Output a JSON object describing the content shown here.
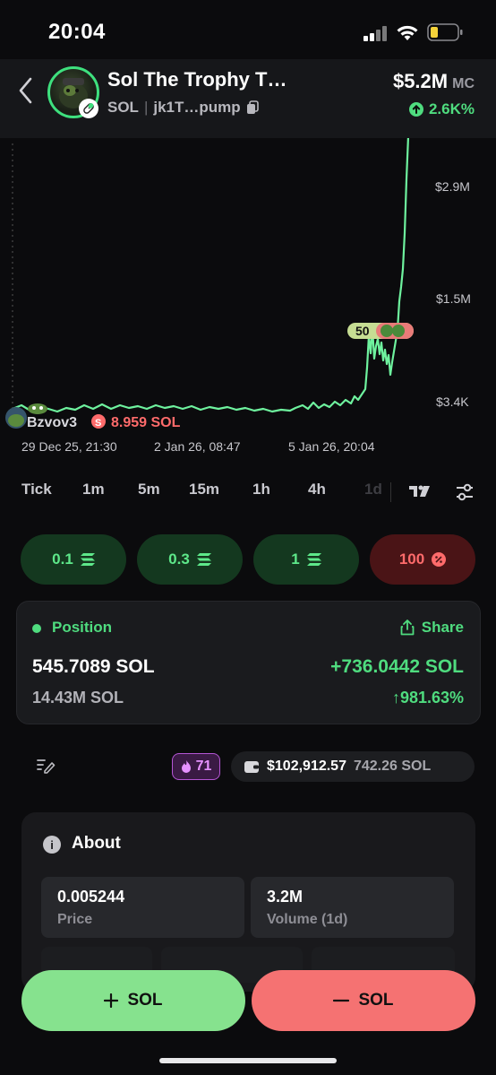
{
  "status_bar": {
    "time": "20:04"
  },
  "token": {
    "name": "Sol The Trophy T…",
    "chain": "SOL",
    "address": "jk1T…pump",
    "market_cap": "$5.2M",
    "market_cap_label": "MC",
    "change": "2.6K%"
  },
  "chart": {
    "y_labels": [
      "$2.9M",
      "$1.5M",
      "$3.4K"
    ],
    "x_labels": [
      "29 Dec 25, 21:30",
      "2 Jan 26, 08:47",
      "5 Jan 26, 20:04"
    ],
    "trade_marker": "50",
    "trader_name": "Bzvov3",
    "trader_side": "S",
    "trader_amount": "8.959 SOL",
    "colors": {
      "line": "#6ef29e",
      "buy": "#4fdc7f",
      "sell": "#ff6b6b"
    }
  },
  "timeframes": [
    "Tick",
    "1m",
    "5m",
    "15m",
    "1h",
    "4h",
    "1d"
  ],
  "quick_amounts": [
    {
      "label": "0.1",
      "side": "buy"
    },
    {
      "label": "0.3",
      "side": "buy"
    },
    {
      "label": "1",
      "side": "buy"
    },
    {
      "label": "100",
      "side": "sell"
    }
  ],
  "position": {
    "title": "Position",
    "share_label": "Share",
    "amount": "545.7089 SOL",
    "pnl": "+736.0442 SOL",
    "total": "14.43M SOL",
    "pnl_pct": "↑981.63%"
  },
  "wallet": {
    "points": "71",
    "usd_balance": "$102,912.57",
    "sol_balance": "742.26 SOL"
  },
  "about": {
    "title": "About",
    "stats": [
      {
        "value": "0.005244",
        "label": "Price"
      },
      {
        "value": "3.2M",
        "label": "Volume (1d)"
      }
    ]
  },
  "actions": {
    "buy_label": "SOL",
    "sell_label": "SOL"
  }
}
